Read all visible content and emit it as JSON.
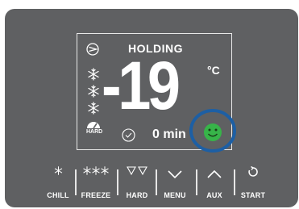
{
  "display": {
    "status": "HOLDING",
    "temperature": "-19",
    "unit": "°C",
    "timer": "0 min",
    "hard_label": "HARD"
  },
  "icons": {
    "compressor": "compressor-icon",
    "snowflake": "snowflake-icon",
    "hard_mode": "hard-mode-gauge-icon",
    "timer_check": "check-circle-icon",
    "smiley": "smiley-face-icon"
  },
  "buttons": [
    {
      "label": "CHILL",
      "icon": "snowflake-icon"
    },
    {
      "label": "FREEZE",
      "icon": "triple-snowflake-icon"
    },
    {
      "label": "HARD",
      "icon": "double-triangle-down-icon"
    },
    {
      "label": "MENU",
      "icon": "chevron-down-icon"
    },
    {
      "label": "AUX",
      "icon": "chevron-up-icon"
    },
    {
      "label": "START",
      "icon": "restart-arrow-icon"
    }
  ],
  "colors": {
    "panel": "#5f6062",
    "text": "#ffffff",
    "smiley": "#37b449",
    "highlight_ring": "#1d5fa4"
  }
}
